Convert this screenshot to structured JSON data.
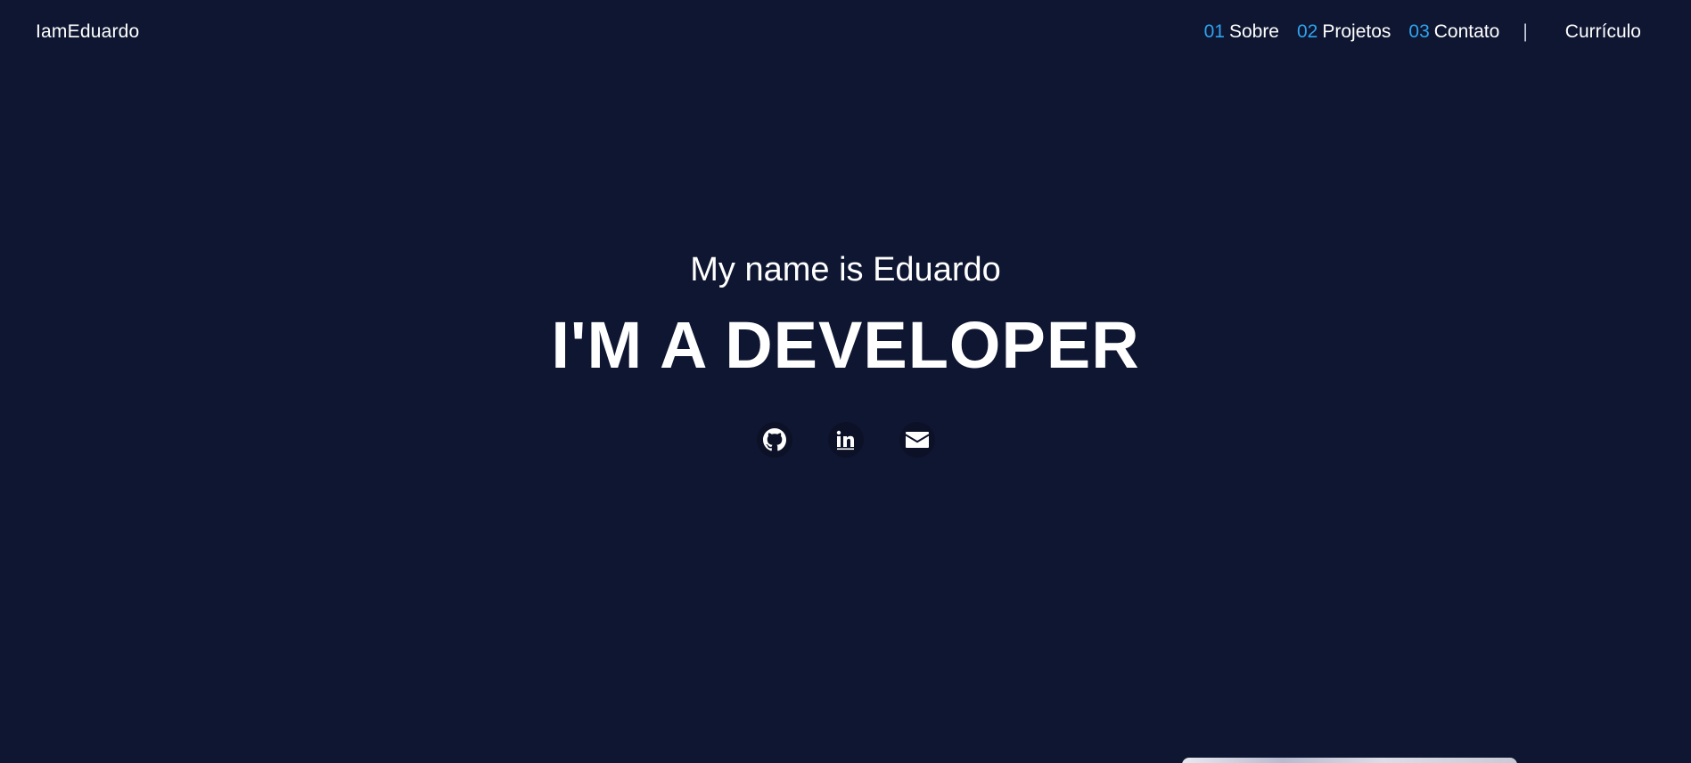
{
  "header": {
    "brand": "IamEduardo",
    "nav": [
      {
        "num": "01",
        "label": "Sobre"
      },
      {
        "num": "02",
        "label": "Projetos"
      },
      {
        "num": "03",
        "label": "Contato"
      }
    ],
    "separator": "|",
    "resume_label": "Currículo"
  },
  "hero": {
    "subtitle": "My name is Eduardo",
    "title": "I'M A DEVELOPER"
  },
  "socials": [
    {
      "icon": "github-icon"
    },
    {
      "icon": "linkedin-icon"
    },
    {
      "icon": "mail-icon"
    }
  ],
  "colors": {
    "background": "#0f1631",
    "accent": "#2fa3f0",
    "text": "#ffffff"
  }
}
